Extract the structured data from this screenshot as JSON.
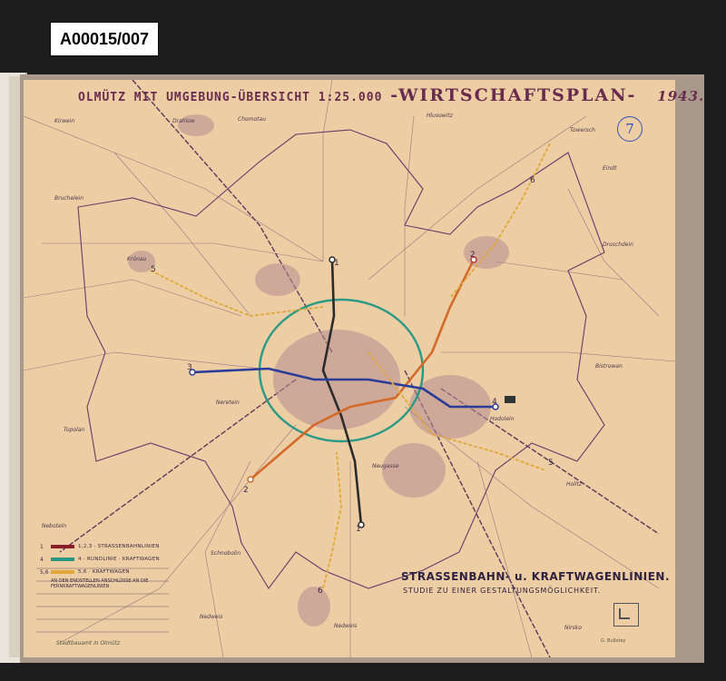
{
  "archive_label": "A00015/007",
  "title": {
    "prefix": "OLMÜTZ MIT UMGEBUNG-ÜBERSICHT 1:25.000",
    "main": "-WIRTSCHAFTSPLAN-",
    "year": "1943."
  },
  "sheet_number": "7",
  "caption": {
    "line1": "STRASSENBAHN- u. KRAFTWAGENLINIEN.",
    "line2": "STUDIE ZU EINER GESTALTUNGSMÖGLICHKEIT."
  },
  "legend": [
    {
      "num": "1",
      "text": "1,2,3 · STRASSENBAHNLINIEN",
      "color": "#8a1f2a"
    },
    {
      "num": "4",
      "text": "4 · RUNDLINIE · KRAFTWAGEN",
      "color": "#2a9a86"
    },
    {
      "num": "5,6",
      "text": "5,6 · KRAFTWAGEN",
      "color": "#e0a83a"
    }
  ],
  "legend_note": "AN DEN ENDSTELLEN ANSCHLÜSSE AN DIE FERNKRAFTWAGENLINIEN",
  "stamp": "Stadtbauamt in Olmütz",
  "signature": "G. Bullotey",
  "places": {
    "p1": "Kirwein",
    "p2": "Drahlow",
    "p3": "Chomotau",
    "p4": "Hlusowitz",
    "p5": "Towersch",
    "p6": "Eindt",
    "p7": "Droschdein",
    "p8": "Bistrowan",
    "p9": "Bruchelein",
    "p10": "Krönau",
    "p11": "Nedweis",
    "p12": "Schnobolin",
    "p13": "Nedweis",
    "p14": "Nirsko",
    "p15": "Holitz",
    "p16": "Neboteln",
    "p17": "Topolan",
    "p18": "Neretein",
    "p19": "Hodolein",
    "p20": "Neugasse"
  },
  "line_numbers": {
    "n1a": "1",
    "n1b": "1",
    "n2a": "2",
    "n2b": "2",
    "n3": "3",
    "n4": "4",
    "n5a": "5",
    "n5b": "5",
    "n6a": "6",
    "n6b": "6"
  },
  "colors": {
    "tram_red": "#8a1f2a",
    "tram_orange": "#d36a2a",
    "tram_blue": "#2a3c9a",
    "tram_black": "#2b2b2b",
    "ring": "#2a9a86",
    "bus": "#e0a83a",
    "roads": "#7a5a7a",
    "paper": "#edcda3"
  }
}
